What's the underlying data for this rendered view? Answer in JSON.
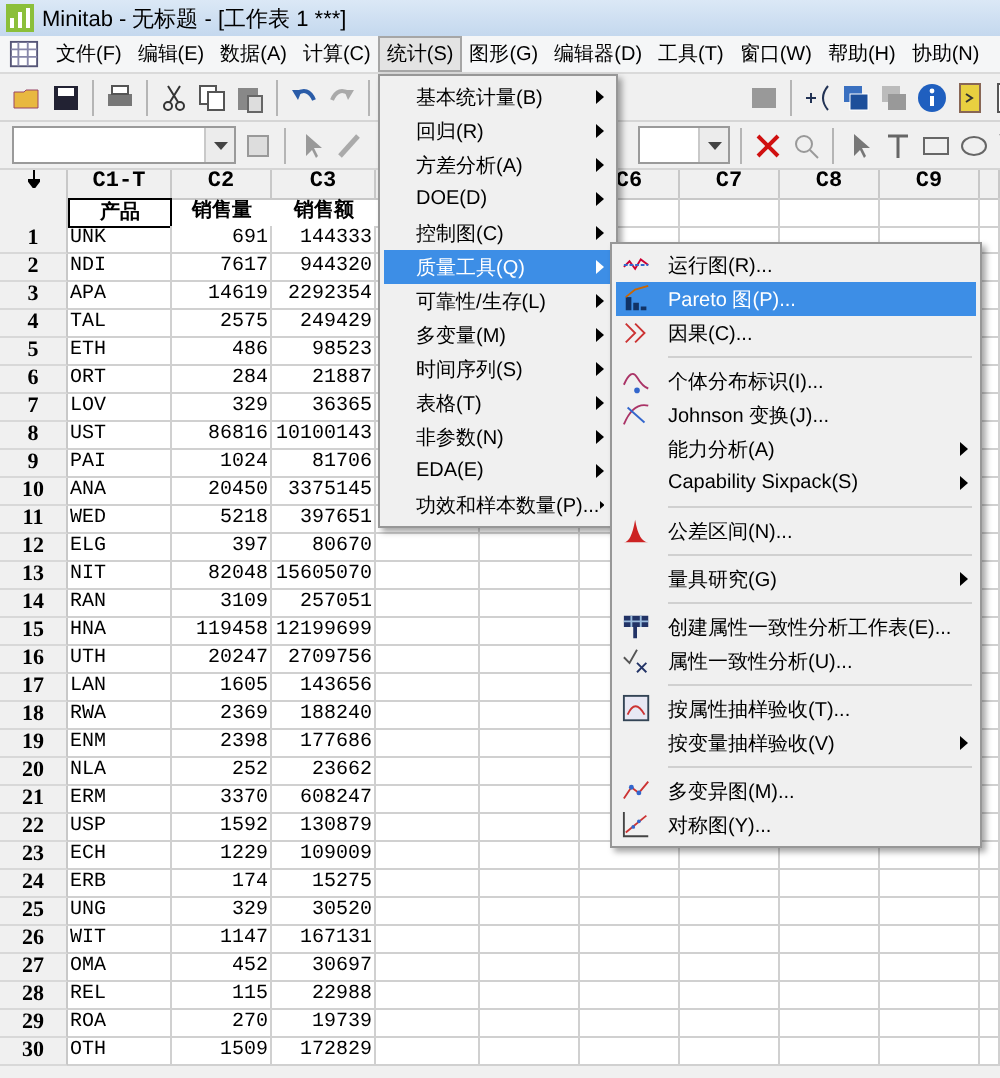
{
  "window": {
    "title": "Minitab - 无标题 - [工作表 1 ***]"
  },
  "menubar": [
    {
      "label": "文件(F)",
      "selected": false
    },
    {
      "label": "编辑(E)",
      "selected": false
    },
    {
      "label": "数据(A)",
      "selected": false
    },
    {
      "label": "计算(C)",
      "selected": false
    },
    {
      "label": "统计(S)",
      "selected": true
    },
    {
      "label": "图形(G)",
      "selected": false
    },
    {
      "label": "编辑器(D)",
      "selected": false
    },
    {
      "label": "工具(T)",
      "selected": false
    },
    {
      "label": "窗口(W)",
      "selected": false
    },
    {
      "label": "帮助(H)",
      "selected": false
    },
    {
      "label": "协助(N)",
      "selected": false
    }
  ],
  "worksheet": {
    "columns": [
      {
        "id": "C1-T",
        "name": "产品",
        "selected": true
      },
      {
        "id": "C2",
        "name": "销售量",
        "selected": false
      },
      {
        "id": "C3",
        "name": "销售额",
        "selected": false
      }
    ],
    "empty_columns": [
      "C6",
      "C7",
      "C8",
      "C9"
    ],
    "rows": [
      {
        "n": "1",
        "cells": [
          "UNK",
          "691",
          "144333"
        ]
      },
      {
        "n": "2",
        "cells": [
          "NDI",
          "7617",
          "944320"
        ]
      },
      {
        "n": "3",
        "cells": [
          "APA",
          "14619",
          "2292354"
        ]
      },
      {
        "n": "4",
        "cells": [
          "TAL",
          "2575",
          "249429"
        ]
      },
      {
        "n": "5",
        "cells": [
          "ETH",
          "486",
          "98523"
        ]
      },
      {
        "n": "6",
        "cells": [
          "ORT",
          "284",
          "21887"
        ]
      },
      {
        "n": "7",
        "cells": [
          "LOV",
          "329",
          "36365"
        ]
      },
      {
        "n": "8",
        "cells": [
          "UST",
          "86816",
          "10100143"
        ]
      },
      {
        "n": "9",
        "cells": [
          "PAI",
          "1024",
          "81706"
        ]
      },
      {
        "n": "10",
        "cells": [
          "ANA",
          "20450",
          "3375145"
        ]
      },
      {
        "n": "11",
        "cells": [
          "WED",
          "5218",
          "397651"
        ]
      },
      {
        "n": "12",
        "cells": [
          "ELG",
          "397",
          "80670"
        ]
      },
      {
        "n": "13",
        "cells": [
          "NIT",
          "82048",
          "15605070"
        ]
      },
      {
        "n": "14",
        "cells": [
          "RAN",
          "3109",
          "257051"
        ]
      },
      {
        "n": "15",
        "cells": [
          "HNA",
          "119458",
          "12199699"
        ]
      },
      {
        "n": "16",
        "cells": [
          "UTH",
          "20247",
          "2709756"
        ]
      },
      {
        "n": "17",
        "cells": [
          "LAN",
          "1605",
          "143656"
        ]
      },
      {
        "n": "18",
        "cells": [
          "RWA",
          "2369",
          "188240"
        ]
      },
      {
        "n": "19",
        "cells": [
          "ENM",
          "2398",
          "177686"
        ]
      },
      {
        "n": "20",
        "cells": [
          "NLA",
          "252",
          "23662"
        ]
      },
      {
        "n": "21",
        "cells": [
          "ERM",
          "3370",
          "608247"
        ]
      },
      {
        "n": "22",
        "cells": [
          "USP",
          "1592",
          "130879"
        ]
      },
      {
        "n": "23",
        "cells": [
          "ECH",
          "1229",
          "109009"
        ]
      },
      {
        "n": "24",
        "cells": [
          "ERB",
          "174",
          "15275"
        ]
      },
      {
        "n": "25",
        "cells": [
          "UNG",
          "329",
          "30520"
        ]
      },
      {
        "n": "26",
        "cells": [
          "WIT",
          "1147",
          "167131"
        ]
      },
      {
        "n": "27",
        "cells": [
          "OMA",
          "452",
          "30697"
        ]
      },
      {
        "n": "28",
        "cells": [
          "REL",
          "115",
          "22988"
        ]
      },
      {
        "n": "29",
        "cells": [
          "ROA",
          "270",
          "19739"
        ]
      },
      {
        "n": "30",
        "cells": [
          "OTH",
          "1509",
          "172829"
        ]
      }
    ]
  },
  "stat_menu": [
    {
      "label": "基本统计量(B)",
      "selected": false,
      "has_submenu": true
    },
    {
      "label": "回归(R)",
      "selected": false,
      "has_submenu": true
    },
    {
      "label": "方差分析(A)",
      "selected": false,
      "has_submenu": true
    },
    {
      "label": "DOE(D)",
      "selected": false,
      "has_submenu": true
    },
    {
      "label": "控制图(C)",
      "selected": false,
      "has_submenu": true
    },
    {
      "label": "质量工具(Q)",
      "selected": true,
      "has_submenu": true
    },
    {
      "label": "可靠性/生存(L)",
      "selected": false,
      "has_submenu": true
    },
    {
      "label": "多变量(M)",
      "selected": false,
      "has_submenu": true
    },
    {
      "label": "时间序列(S)",
      "selected": false,
      "has_submenu": true
    },
    {
      "label": "表格(T)",
      "selected": false,
      "has_submenu": true
    },
    {
      "label": "非参数(N)",
      "selected": false,
      "has_submenu": true
    },
    {
      "label": "EDA(E)",
      "selected": false,
      "has_submenu": true
    },
    {
      "label": "功效和样本数量(P)...",
      "selected": false,
      "has_submenu": true
    }
  ],
  "quality_menu": [
    {
      "kind": "item",
      "label": "运行图(R)...",
      "selected": false,
      "has_submenu": false
    },
    {
      "kind": "item",
      "label": "Pareto 图(P)...",
      "selected": true,
      "has_submenu": false
    },
    {
      "kind": "item",
      "label": "因果(C)...",
      "selected": false,
      "has_submenu": false
    },
    {
      "kind": "separator"
    },
    {
      "kind": "item",
      "label": "个体分布标识(I)...",
      "selected": false,
      "has_submenu": false
    },
    {
      "kind": "item",
      "label": "Johnson 变换(J)...",
      "selected": false,
      "has_submenu": false
    },
    {
      "kind": "item",
      "label": "能力分析(A)",
      "selected": false,
      "has_submenu": true
    },
    {
      "kind": "item",
      "label": "Capability Sixpack(S)",
      "selected": false,
      "has_submenu": true
    },
    {
      "kind": "separator"
    },
    {
      "kind": "item",
      "label": "公差区间(N)...",
      "selected": false,
      "has_submenu": false
    },
    {
      "kind": "separator"
    },
    {
      "kind": "item",
      "label": "量具研究(G)",
      "selected": false,
      "has_submenu": true
    },
    {
      "kind": "separator"
    },
    {
      "kind": "item",
      "label": "创建属性一致性分析工作表(E)...",
      "selected": false,
      "has_submenu": false
    },
    {
      "kind": "item",
      "label": "属性一致性分析(U)...",
      "selected": false,
      "has_submenu": false
    },
    {
      "kind": "separator"
    },
    {
      "kind": "item",
      "label": "按属性抽样验收(T)...",
      "selected": false,
      "has_submenu": false
    },
    {
      "kind": "item",
      "label": "按变量抽样验收(V)",
      "selected": false,
      "has_submenu": true
    },
    {
      "kind": "separator"
    },
    {
      "kind": "item",
      "label": "多变异图(M)...",
      "selected": false,
      "has_submenu": false
    },
    {
      "kind": "item",
      "label": "对称图(Y)...",
      "selected": false,
      "has_submenu": false
    }
  ]
}
